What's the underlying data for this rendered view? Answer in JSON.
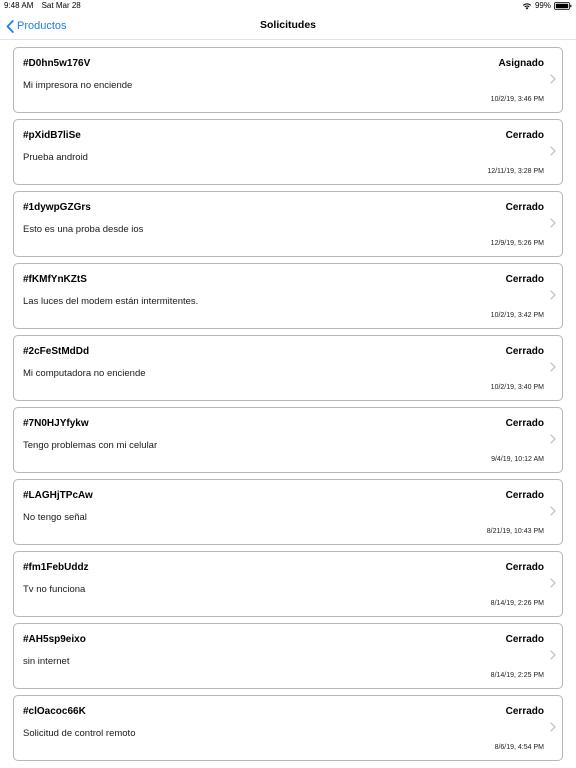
{
  "status_bar": {
    "time": "9:48 AM",
    "date": "Sat Mar 28",
    "battery": "99%"
  },
  "nav": {
    "back_label": "Productos",
    "title": "Solicitudes"
  },
  "requests": [
    {
      "id": "#D0hn5w176V",
      "status": "Asignado",
      "description": "Mi impresora no enciende",
      "date": "10/2/19, 3:46 PM"
    },
    {
      "id": "#pXidB7liSe",
      "status": "Cerrado",
      "description": "Prueba android",
      "date": "12/11/19, 3:28 PM"
    },
    {
      "id": "#1dywpGZGrs",
      "status": "Cerrado",
      "description": "Esto es una proba desde ios",
      "date": "12/9/19, 5:26 PM"
    },
    {
      "id": "#fKMfYnKZtS",
      "status": "Cerrado",
      "description": "Las luces del modem están intermitentes.",
      "date": "10/2/19, 3:42 PM"
    },
    {
      "id": "#2cFeStMdDd",
      "status": "Cerrado",
      "description": "Mi computadora no enciende",
      "date": "10/2/19, 3:40 PM"
    },
    {
      "id": "#7N0HJYfykw",
      "status": "Cerrado",
      "description": "Tengo problemas con mi celular",
      "date": "9/4/19, 10:12 AM"
    },
    {
      "id": "#LAGHjTPcAw",
      "status": "Cerrado",
      "description": "No tengo señal",
      "date": "8/21/19, 10:43 PM"
    },
    {
      "id": "#fm1FebUddz",
      "status": "Cerrado",
      "description": "Tv no funciona",
      "date": "8/14/19, 2:26 PM"
    },
    {
      "id": "#AH5sp9eixo",
      "status": "Cerrado",
      "description": "sin internet",
      "date": "8/14/19, 2:25 PM"
    },
    {
      "id": "#clOacoc66K",
      "status": "Cerrado",
      "description": "Solicitud de control remoto",
      "date": "8/6/19, 4:54 PM"
    }
  ],
  "colors": {
    "accent": "#1c7ef2",
    "card_border": "#b7b7b9",
    "chevron": "#c4c4c7"
  }
}
